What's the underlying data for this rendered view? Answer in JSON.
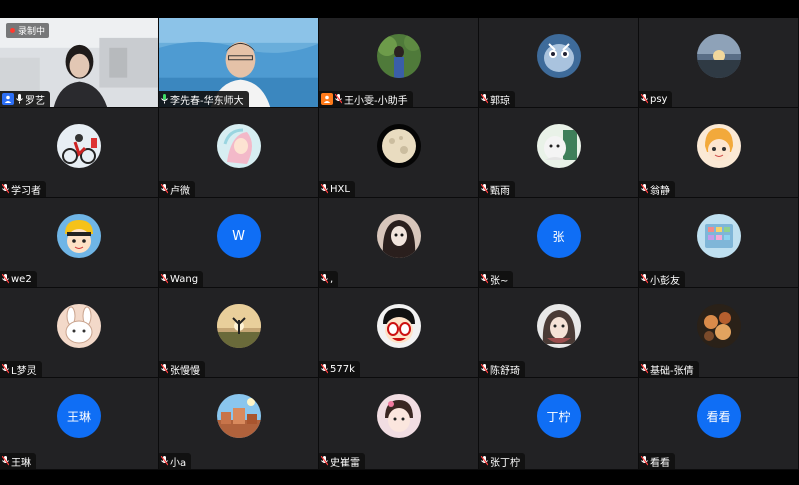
{
  "recording": {
    "label": "录制中"
  },
  "participants": [
    {
      "name": "罗艺"
    },
    {
      "name": "李先春-华东师大"
    },
    {
      "name": "王小雯-小助手"
    },
    {
      "name": "郭琼"
    },
    {
      "name": "psy"
    },
    {
      "name": "学习者"
    },
    {
      "name": "卢微"
    },
    {
      "name": "HXL"
    },
    {
      "name": "甄雨"
    },
    {
      "name": "翁静"
    },
    {
      "name": "we2"
    },
    {
      "name": "Wang",
      "initial": "W"
    },
    {
      "name": ","
    },
    {
      "name": "张~",
      "initial": "张"
    },
    {
      "name": "小彭友"
    },
    {
      "name": "L梦灵"
    },
    {
      "name": "张慢慢"
    },
    {
      "name": "577k"
    },
    {
      "name": "陈舒琦"
    },
    {
      "name": "基础-张倩"
    },
    {
      "name": "王琳",
      "initial": "王琳"
    },
    {
      "name": "小a"
    },
    {
      "name": "史崔雷"
    },
    {
      "name": "张丁柠",
      "initial": "丁柠"
    },
    {
      "name": "看看",
      "initial": "看看"
    }
  ],
  "colors": {
    "tile_bg": "#222224",
    "avatar_letter_bg": "#0f6ef5",
    "host_badge": "#2d6ff5",
    "cohost_badge": "#ff7a1a",
    "record_dot": "#ff3b30"
  }
}
